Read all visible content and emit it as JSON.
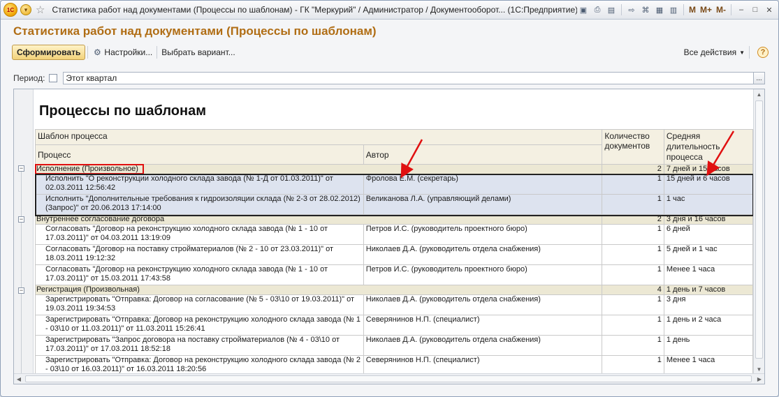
{
  "window": {
    "title": "Статистика работ над документами (Процессы по шаблонам) - ГК \"Меркурий\" / Администратор / Документооборот... (1С:Предприятие)",
    "logo": "1С",
    "m_buttons": [
      "M",
      "M+",
      "M-"
    ]
  },
  "page": {
    "title": "Статистика работ над документами (Процессы по шаблонам)"
  },
  "toolbar": {
    "generate_label": "Сформировать",
    "settings_label": "Настройки...",
    "variant_label": "Выбрать вариант...",
    "all_actions_label": "Все действия",
    "help_label": "?"
  },
  "period": {
    "label": "Период:",
    "value": "Этот квартал",
    "dots": "..."
  },
  "report": {
    "heading": "Процессы по шаблонам",
    "headers": {
      "template": "Шаблон процесса",
      "process": "Процесс",
      "author": "Автор",
      "doc_count": "Количество документов",
      "avg_duration": "Средняя длительность процесса"
    },
    "groups": [
      {
        "name": "Исполнение (Произвольное)",
        "count": "2",
        "duration": "7 дней и 15 часов",
        "rows": [
          {
            "process": "Исполнить \"О реконструкции холодного склада завода (№ 1-Д от 01.03.2011)\" от 02.03.2011 12:56:42",
            "author": "Фролова Е.М. (секретарь)",
            "count": "1",
            "duration": "15 дней и 6 часов"
          },
          {
            "process": "Исполнить \"Дополнительные требования к гидроизоляции склада (№ 2-3 от 28.02.2012) (Запрос)\" от 20.06.2013 17:14:00",
            "author": "Великанова Л.А. (управляющий делами)",
            "count": "1",
            "duration": "1 час"
          }
        ]
      },
      {
        "name": "Внутреннее согласование договора",
        "count": "2",
        "duration": "3 дня и 16 часов",
        "rows": [
          {
            "process": "Согласовать \"Договор на реконструкцию холодного склада завода (№ 1 - 10 от 17.03.2011)\" от 04.03.2011 13:19:09",
            "author": "Петров И.С. (руководитель проектного бюро)",
            "count": "1",
            "duration": "6 дней"
          },
          {
            "process": "Согласовать \"Договор на поставку стройматериалов (№ 2 - 10 от 23.03.2011)\" от 18.03.2011 19:12:32",
            "author": "Николаев Д.А. (руководитель отдела снабжения)",
            "count": "1",
            "duration": "5 дней и 1 час"
          },
          {
            "process": "Согласовать \"Договор на реконструкцию холодного склада завода (№ 1 - 10 от 17.03.2011)\" от 15.03.2011 17:43:58",
            "author": "Петров И.С. (руководитель проектного бюро)",
            "count": "1",
            "duration": "Менее 1 часа"
          }
        ]
      },
      {
        "name": "Регистрация (Произвольная)",
        "count": "4",
        "duration": "1 день и 7 часов",
        "rows": [
          {
            "process": "Зарегистрировать \"Отправка: Договор на согласование (№ 5 - 03\\10 от 19.03.2011)\" от 19.03.2011 19:34:53",
            "author": "Николаев Д.А. (руководитель отдела снабжения)",
            "count": "1",
            "duration": "3 дня"
          },
          {
            "process": "Зарегистрировать \"Отправка: Договор на реконструкцию холодного склада завода (№ 1 - 03\\10 от 11.03.2011)\" от 11.03.2011 15:26:41",
            "author": "Северянинов Н.П. (специалист)",
            "count": "1",
            "duration": "1 день и 2 часа"
          },
          {
            "process": "Зарегистрировать \"Запрос договора на поставку стройматериалов (№ 4 - 03\\10 от 17.03.2011)\" от 17.03.2011 18:52:18",
            "author": "Николаев Д.А. (руководитель отдела снабжения)",
            "count": "1",
            "duration": "1 день"
          },
          {
            "process": "Зарегистрировать \"Отправка: Договор на реконструкцию холодного склада завода (№ 2 - 03\\10 от 16.03.2011)\" от 16.03.2011 18:20:56",
            "author": "Северянинов Н.П. (специалист)",
            "count": "1",
            "duration": "Менее 1 часа"
          }
        ]
      }
    ]
  },
  "colors": {
    "accent_title": "#b06d14",
    "annotation_red": "#e01010",
    "group_row": "#ece8d4",
    "selection": "#dde3ef"
  }
}
